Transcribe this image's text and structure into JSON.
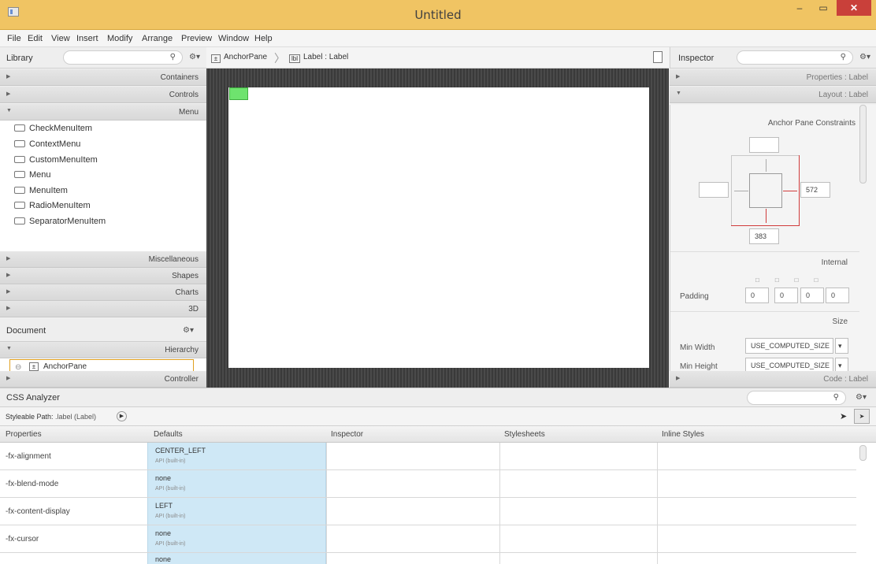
{
  "window": {
    "title": "Untitled",
    "min": "–",
    "max": "▭",
    "close": "✕"
  },
  "menu": [
    "File",
    "Edit",
    "View",
    "Insert",
    "Modify",
    "Arrange",
    "Preview",
    "Window",
    "Help"
  ],
  "library": {
    "title": "Library",
    "sections_top": [
      "Containers",
      "Controls",
      "Menu"
    ],
    "items": [
      "CheckMenuItem",
      "ContextMenu",
      "CustomMenuItem",
      "Menu",
      "MenuItem",
      "RadioMenuItem",
      "SeparatorMenuItem"
    ],
    "sections_bottom": [
      "Miscellaneous",
      "Shapes",
      "Charts",
      "3D"
    ]
  },
  "document": {
    "title": "Document",
    "hierarchy": "Hierarchy",
    "tree_item": "AnchorPane",
    "controller": "Controller"
  },
  "breadcrumb": {
    "root": "AnchorPane",
    "leaf": "Label : Label"
  },
  "inspector": {
    "title": "Inspector",
    "properties": "Properties : Label",
    "layout": "Layout : Label",
    "constraints_title": "Anchor Pane Constraints",
    "right_value": "572",
    "bottom_value": "383",
    "internal": "Internal",
    "padding_label": "Padding",
    "padding": [
      "0",
      "0",
      "0",
      "0"
    ],
    "size": "Size",
    "min_width_label": "Min Width",
    "min_width_value": "USE_COMPUTED_SIZE",
    "min_height_label": "Min Height",
    "min_height_value": "USE_COMPUTED_SIZE",
    "code": "Code : Label"
  },
  "css": {
    "title": "CSS Analyzer",
    "path_label": "Styleable Path:",
    "path_value": ".label (Label)",
    "columns": [
      "Properties",
      "Defaults",
      "Inspector",
      "Stylesheets",
      "Inline Styles"
    ],
    "rows": [
      {
        "prop": "-fx-alignment",
        "value": "CENTER_LEFT",
        "source": "API (built-in)"
      },
      {
        "prop": "-fx-blend-mode",
        "value": "none",
        "source": "API (built-in)"
      },
      {
        "prop": "-fx-content-display",
        "value": "LEFT",
        "source": "API (built-in)"
      },
      {
        "prop": "-fx-cursor",
        "value": "none",
        "source": "API (built-in)"
      },
      {
        "prop": "",
        "value": "none",
        "source": ""
      }
    ]
  }
}
